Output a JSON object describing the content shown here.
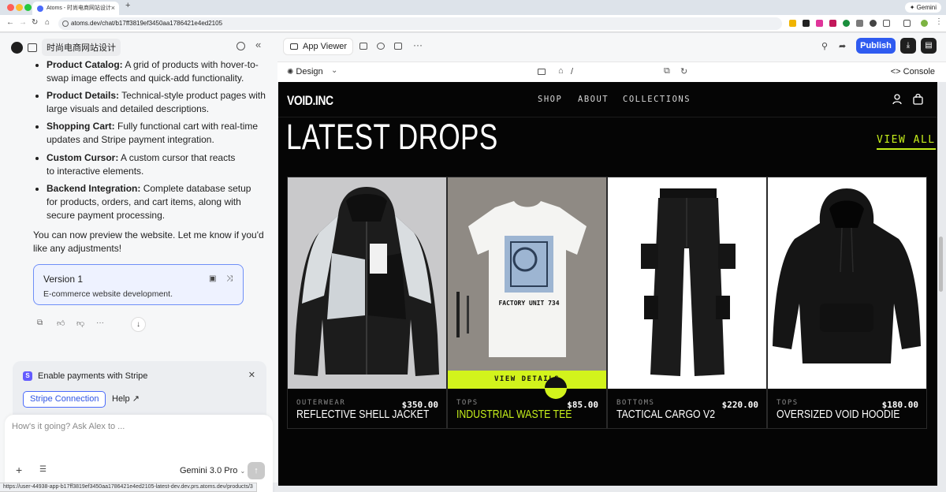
{
  "browser": {
    "tab_title": "Atoms - 时尚电商网站设计",
    "url": "atoms.dev/chat/b17ff3819ef3450aa1786421e4ed2105",
    "profile_label": "Gemini",
    "status_url": "https://user-44938-app-b17ff3819ef3450aa1786421e4ed2105-latest-dev.dev.prs.atoms.dev/products/3"
  },
  "chat": {
    "project_title": "时尚电商网站设计",
    "features": [
      {
        "label": "Product Catalog:",
        "text": " A grid of products with hover-to-swap image effects and quick-add functionality."
      },
      {
        "label": "Product Details:",
        "text": " Technical-style product pages with large visuals and detailed descriptions."
      },
      {
        "label": "Shopping Cart:",
        "text": " Fully functional cart with real-time updates and Stripe payment integration."
      },
      {
        "label": "Custom Cursor:",
        "text": " A custom cursor that reacts to interactive elements."
      },
      {
        "label": "Backend Integration:",
        "text": " Complete database setup for products, orders, and cart items, along with secure payment processing."
      }
    ],
    "closing_message": "You can now preview the website. Let me know if you'd like any adjustments!",
    "version": {
      "title": "Version 1",
      "description": "E-commerce website development."
    },
    "stripe": {
      "title": "Enable payments with Stripe",
      "connect_label": "Stripe Connection",
      "help_label": "Help"
    },
    "input_placeholder": "How's it going? Ask Alex to ...",
    "model": "Gemini 3.0 Pro"
  },
  "toolbar": {
    "app_viewer_label": "App Viewer",
    "publish_label": "Publish",
    "design_label": "Design",
    "path": "/",
    "console_label": "Console"
  },
  "site": {
    "brand": "VOID.INC",
    "nav": [
      "SHOP",
      "ABOUT",
      "COLLECTIONS"
    ],
    "heading": "LATEST DROPS",
    "view_all": "VIEW ALL",
    "view_details": "VIEW DETAILS",
    "products": [
      {
        "category": "OUTERWEAR",
        "name": "REFLECTIVE SHELL JACKET",
        "price": "$350.00"
      },
      {
        "category": "TOPS",
        "name": "INDUSTRIAL WASTE TEE",
        "price": "$85.00",
        "print_text": "FACTORY UNIT 734"
      },
      {
        "category": "BOTTOMS",
        "name": "TACTICAL CARGO V2",
        "price": "$220.00"
      },
      {
        "category": "TOPS",
        "name": "OVERSIZED VOID HOODIE",
        "price": "$180.00"
      }
    ],
    "accent_color": "#d2f31c"
  }
}
